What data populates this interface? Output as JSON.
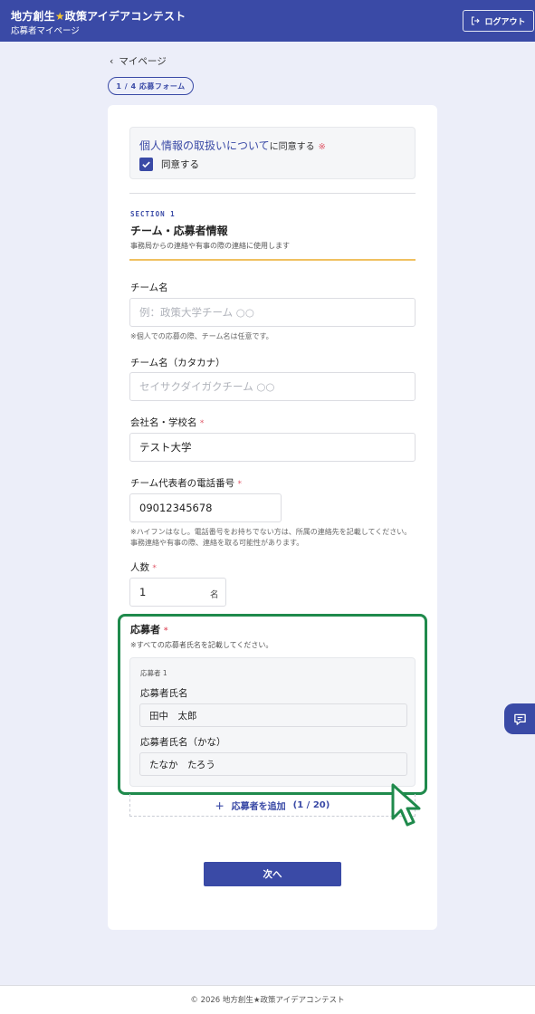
{
  "header": {
    "title_part1": "地方創生",
    "title_star": "★",
    "title_part2": "政策アイデアコンテスト",
    "subtitle": "応募者マイページ",
    "logout_label": "ログアウト"
  },
  "nav": {
    "back_label": "マイページ",
    "step_label": "1 / 4 応募フォーム"
  },
  "consent": {
    "link_text": "個人情報の取扱いについて",
    "suffix": "に同意する",
    "required_mark": "※",
    "checkbox_label": "同意する",
    "checked": true
  },
  "section": {
    "label": "SECTION 1",
    "title": "チーム・応募者情報",
    "description": "事務局からの連絡や有事の際の連絡に使用します"
  },
  "fields": {
    "team_name": {
      "label": "チーム名",
      "placeholder": "例：政策大学チーム ○○",
      "note": "※個人での応募の際、チーム名は任意です。"
    },
    "team_kana": {
      "label": "チーム名（カタカナ）",
      "placeholder": "セイサクダイガクチーム ○○"
    },
    "company": {
      "label": "会社名・学校名",
      "required": "*",
      "value": "テスト大学"
    },
    "phone": {
      "label": "チーム代表者の電話番号",
      "required": "*",
      "value": "09012345678",
      "note": "※ハイフンはなし。電話番号をお持ちでない方は、所属の連絡先を記載してください。事務連絡や有事の際、連絡を取る可能性があります。"
    },
    "count": {
      "label": "人数",
      "required": "*",
      "value": "1",
      "unit": "名"
    }
  },
  "applicants": {
    "title": "応募者",
    "required": "*",
    "hint": "※すべての応募者氏名を記載してください。",
    "items": [
      {
        "index_label": "応募者 1",
        "name_label": "応募者氏名",
        "name_value": "田中　太郎",
        "kana_label": "応募者氏名（かな）",
        "kana_value": "たなか　たろう"
      }
    ],
    "add_label": "応募者を追加",
    "add_count": "(1 / 20)"
  },
  "actions": {
    "next_label": "次へ"
  },
  "footer": {
    "copyright": "© 2026 地方創生★政策アイデアコンテスト"
  },
  "colors": {
    "brand": "#3a4aa6",
    "required": "#e05a6a",
    "highlight": "#1f8a4c",
    "accent_line": "#f0c060"
  }
}
